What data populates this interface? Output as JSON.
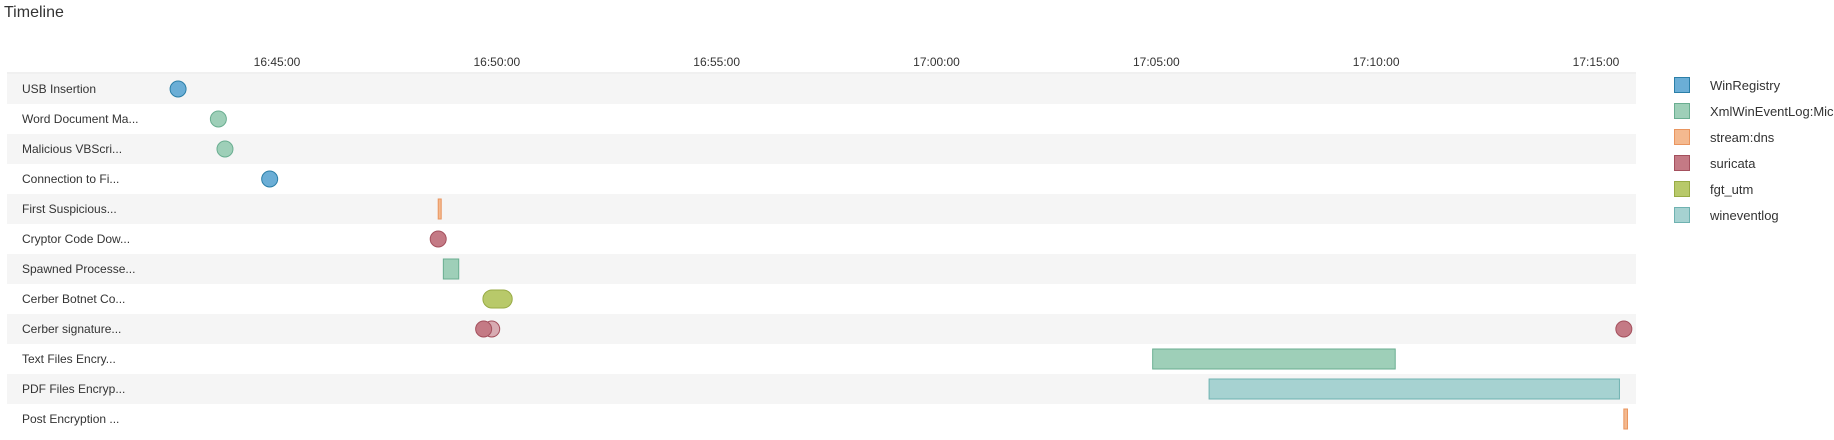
{
  "chart_data": {
    "type": "timeline",
    "title": "Timeline",
    "x_ticks": [
      "16:45:00",
      "16:50:00",
      "16:55:00",
      "17:00:00",
      "17:05:00",
      "17:10:00",
      "17:15:00"
    ],
    "xlim": [
      "16:42:45",
      "17:15:40"
    ],
    "legend_position": "right",
    "grid": false,
    "series": [
      {
        "name": "WinRegistry",
        "fill": "#6baed6",
        "stroke": "#2b7fa8"
      },
      {
        "name": "XmlWinEventLog:Microsoft-Windows-Sysmon/Operational",
        "fill": "#9ecfb8",
        "stroke": "#6aae91"
      },
      {
        "name": "stream:dns",
        "fill": "#f4b98f",
        "stroke": "#e9955f"
      },
      {
        "name": "suricata",
        "fill": "#c47a85",
        "stroke": "#a4505d"
      },
      {
        "name": "fgt_utm",
        "fill": "#b8c96a",
        "stroke": "#98ab45"
      },
      {
        "name": "wineventlog",
        "fill": "#a6d2d1",
        "stroke": "#6fb2b1"
      }
    ],
    "rows": [
      {
        "label": "USB Insertion",
        "events": [
          {
            "series": "WinRegistry",
            "shape": "point",
            "time": "16:42:45"
          }
        ]
      },
      {
        "label": "Word Document Ma...",
        "events": [
          {
            "series": "XmlWinEventLog:Microsoft-Windows-Sysmon/Operational",
            "shape": "point",
            "time": "16:43:40"
          }
        ]
      },
      {
        "label": "Malicious VBScri...",
        "events": [
          {
            "series": "XmlWinEventLog:Microsoft-Windows-Sysmon/Operational",
            "shape": "point",
            "time": "16:43:49"
          }
        ]
      },
      {
        "label": "Connection to Fi...",
        "events": [
          {
            "series": "WinRegistry",
            "shape": "point",
            "time": "16:44:50"
          }
        ]
      },
      {
        "label": "First Suspicious...",
        "events": [
          {
            "series": "stream:dns",
            "shape": "bar",
            "start": "16:48:40",
            "end": "16:48:44"
          }
        ]
      },
      {
        "label": "Cryptor Code Dow...",
        "events": [
          {
            "series": "suricata",
            "shape": "point",
            "time": "16:48:40"
          }
        ]
      },
      {
        "label": "Spawned Processe...",
        "events": [
          {
            "series": "XmlWinEventLog:Microsoft-Windows-Sysmon/Operational",
            "shape": "bar",
            "start": "16:48:47",
            "end": "16:49:08"
          }
        ]
      },
      {
        "label": "Cerber Botnet Co...",
        "events": [
          {
            "series": "fgt_utm",
            "shape": "bar",
            "start": "16:49:41",
            "end": "16:50:21"
          }
        ]
      },
      {
        "label": "Cerber signature...",
        "events": [
          {
            "series": "suricata",
            "shape": "point",
            "time": "16:49:53",
            "opacity": 0.6
          },
          {
            "series": "suricata",
            "shape": "point",
            "time": "16:49:42"
          },
          {
            "series": "suricata",
            "shape": "point",
            "time": "17:15:38"
          }
        ]
      },
      {
        "label": "Text Files Encry...",
        "events": [
          {
            "series": "XmlWinEventLog:Microsoft-Windows-Sysmon/Operational",
            "shape": "bar",
            "start": "17:04:55",
            "end": "17:10:26"
          }
        ]
      },
      {
        "label": "PDF Files Encryp...",
        "events": [
          {
            "series": "wineventlog",
            "shape": "bar",
            "start": "17:06:12",
            "end": "17:15:32"
          }
        ]
      },
      {
        "label": "Post Encryption ...",
        "events": [
          {
            "series": "stream:dns",
            "shape": "bar",
            "start": "17:15:38",
            "end": "17:15:43"
          }
        ]
      }
    ]
  }
}
